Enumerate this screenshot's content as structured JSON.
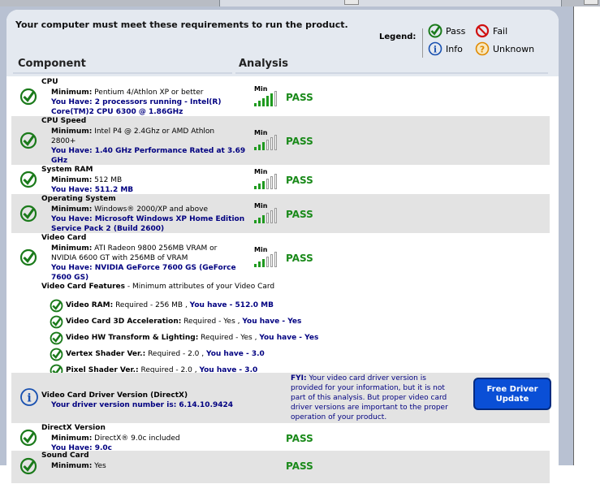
{
  "header": {
    "requirements_text": "Your computer must meet these requirements to run the product.",
    "legend_label": "Legend:",
    "legend": {
      "pass": "Pass",
      "fail": "Fail",
      "info": "Info",
      "unknown": "Unknown"
    },
    "col_component": "Component",
    "col_analysis": "Analysis"
  },
  "colors": {
    "pass_green": "#1a8a1a",
    "have_blue": "#000080",
    "button_blue": "#0a4fd6",
    "row_shade": "#e3e3e3",
    "frame": "#b8c1d2"
  },
  "meter_label": "Min",
  "rows": [
    {
      "name": "CPU",
      "min_label": "Minimum:",
      "min": "Pentium 4/Athlon XP or better",
      "have_label": "You Have:",
      "have_line1": "2 processors running - Intel(R)",
      "have_line2": "Core(TM)2 CPU 6300 @ 1.86GHz",
      "result": "PASS",
      "meter_level": 5
    },
    {
      "name": "CPU Speed",
      "min_label": "Minimum:",
      "min": "Intel P4 @ 2.4Ghz or AMD Athlon",
      "min_line2": "2800+",
      "have_label": "You Have:",
      "have_line1": "1.40 GHz Performance Rated at 3.69",
      "have_line2": "GHz",
      "result": "PASS",
      "meter_level": 3
    },
    {
      "name": "System RAM",
      "min_label": "Minimum:",
      "min": "512 MB",
      "have_label": "You Have:",
      "have_line1": "511.2 MB",
      "result": "PASS",
      "meter_level": 3
    },
    {
      "name": "Operating System",
      "min_label": "Minimum:",
      "min": "Windows® 2000/XP and above",
      "have_label": "You Have:",
      "have_line1": "Microsoft Windows XP Home Edition",
      "have_line2": "Service Pack 2 (Build 2600)",
      "result": "PASS",
      "meter_level": 3
    },
    {
      "name": "Video Card",
      "min_label": "Minimum:",
      "min": "ATI Radeon 9800 256MB VRAM or",
      "min_line2": "NVIDIA 6600 GT with 256MB of VRAM",
      "have_label": "You Have:",
      "have_line1": "NVIDIA GeForce 7600 GS (GeForce",
      "have_line2": "7600 GS)",
      "result": "PASS",
      "meter_level": 3
    }
  ],
  "features": {
    "title": "Video Card Features",
    "subtitle": " - Minimum attributes of your Video Card",
    "items": [
      {
        "name": "Video RAM:",
        "req": " Required - 256 MB , ",
        "have": "You have - 512.0 MB"
      },
      {
        "name": "Video Card 3D Acceleration:",
        "req": " Required - Yes , ",
        "have": "You have - Yes"
      },
      {
        "name": "Video HW Transform & Lighting:",
        "req": " Required - Yes , ",
        "have": "You have - Yes"
      },
      {
        "name": "Vertex Shader Ver.:",
        "req": " Required - 2.0 , ",
        "have": "You have - 3.0"
      },
      {
        "name": "Pixel Shader Ver.:",
        "req": " Required - 2.0 , ",
        "have": "You have - 3.0"
      }
    ]
  },
  "driver": {
    "name": "Video Card Driver Version (DirectX)",
    "version_text": "Your driver version number is: 6.14.10.9424",
    "fyi_label": "FYI:",
    "fyi_line1": " Your video card driver version is",
    "fyi_line2": "provided for your information, but it is not",
    "fyi_line3": "part of this analysis. But proper video card",
    "fyi_line4": "driver versions are important to the proper",
    "fyi_line5": "operation of your product.",
    "button_line1": "Free Driver",
    "button_line2": "Update"
  },
  "directx": {
    "name": "DirectX Version",
    "min_label": "Minimum:",
    "min": "DirectX® 9.0c included",
    "have_label": "You Have:",
    "have_line1": "9.0c",
    "result": "PASS"
  },
  "sound": {
    "name": "Sound Card",
    "min_label": "Minimum:",
    "min": "Yes",
    "result": "PASS"
  }
}
